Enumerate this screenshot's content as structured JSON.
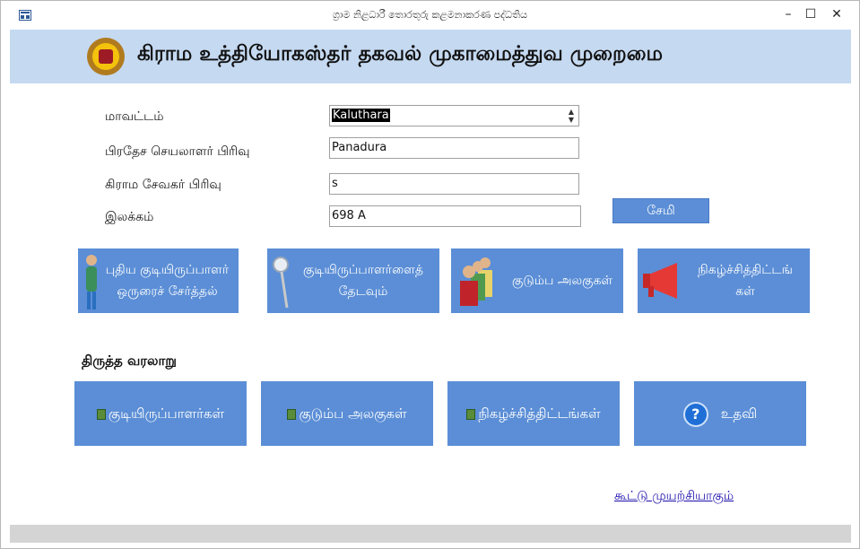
{
  "window": {
    "title": "ග්‍රාම නිළධාරී තොරතුරු කළමනාකරණ පද්ධතිය",
    "minimize": "–",
    "maximize": "☐",
    "close": "✕"
  },
  "header": {
    "title": "கிராம உத்தியோகஸ்தர் தகவல் முகாமைத்துவ முறைமை",
    "emblem_icon": "sri-lanka-emblem"
  },
  "form": {
    "district_label": "மாவட்டம்",
    "district_value": "Kaluthara",
    "ds_label": "பிரதேச செயலாளர் பிரிவு",
    "ds_value": "Panadura",
    "gn_label": "கிராம சேவகர் பிரிவு",
    "gn_value": "s",
    "number_label": "இலக்கம்",
    "number_value": "698 A",
    "save_label": "சேமி"
  },
  "main_buttons": [
    {
      "line1": "புதிய குடியிருப்பாளர்",
      "line2": "ஒருரைச் சேர்த்தல்",
      "icon": "person-icon"
    },
    {
      "line1": "குடியிருப்பாளர்ளைத்",
      "line2": "தேடவும்",
      "icon": "magnifier-icon"
    },
    {
      "line1": "குடும்ப அலகுகள்",
      "line2": "",
      "icon": "family-group-icon"
    },
    {
      "line1": "நிகழ்ச்சித்திட்டங்",
      "line2": "கள்",
      "icon": "megaphone-icon"
    }
  ],
  "history": {
    "label": "திருத்த வரலாறு",
    "buttons": [
      "குடியிருப்பாளர்கள்",
      "குடும்ப அலகுகள்",
      "நிகழ்ச்சித்திட்டங்கள்",
      "உதவி"
    ],
    "help_glyph": "?"
  },
  "link": {
    "text": "கூட்டு முயற்சியாகும்"
  },
  "colors": {
    "header_bg": "#c5d9f1",
    "button_bg": "#5b8ed6",
    "footer": "#d4d4d4"
  }
}
